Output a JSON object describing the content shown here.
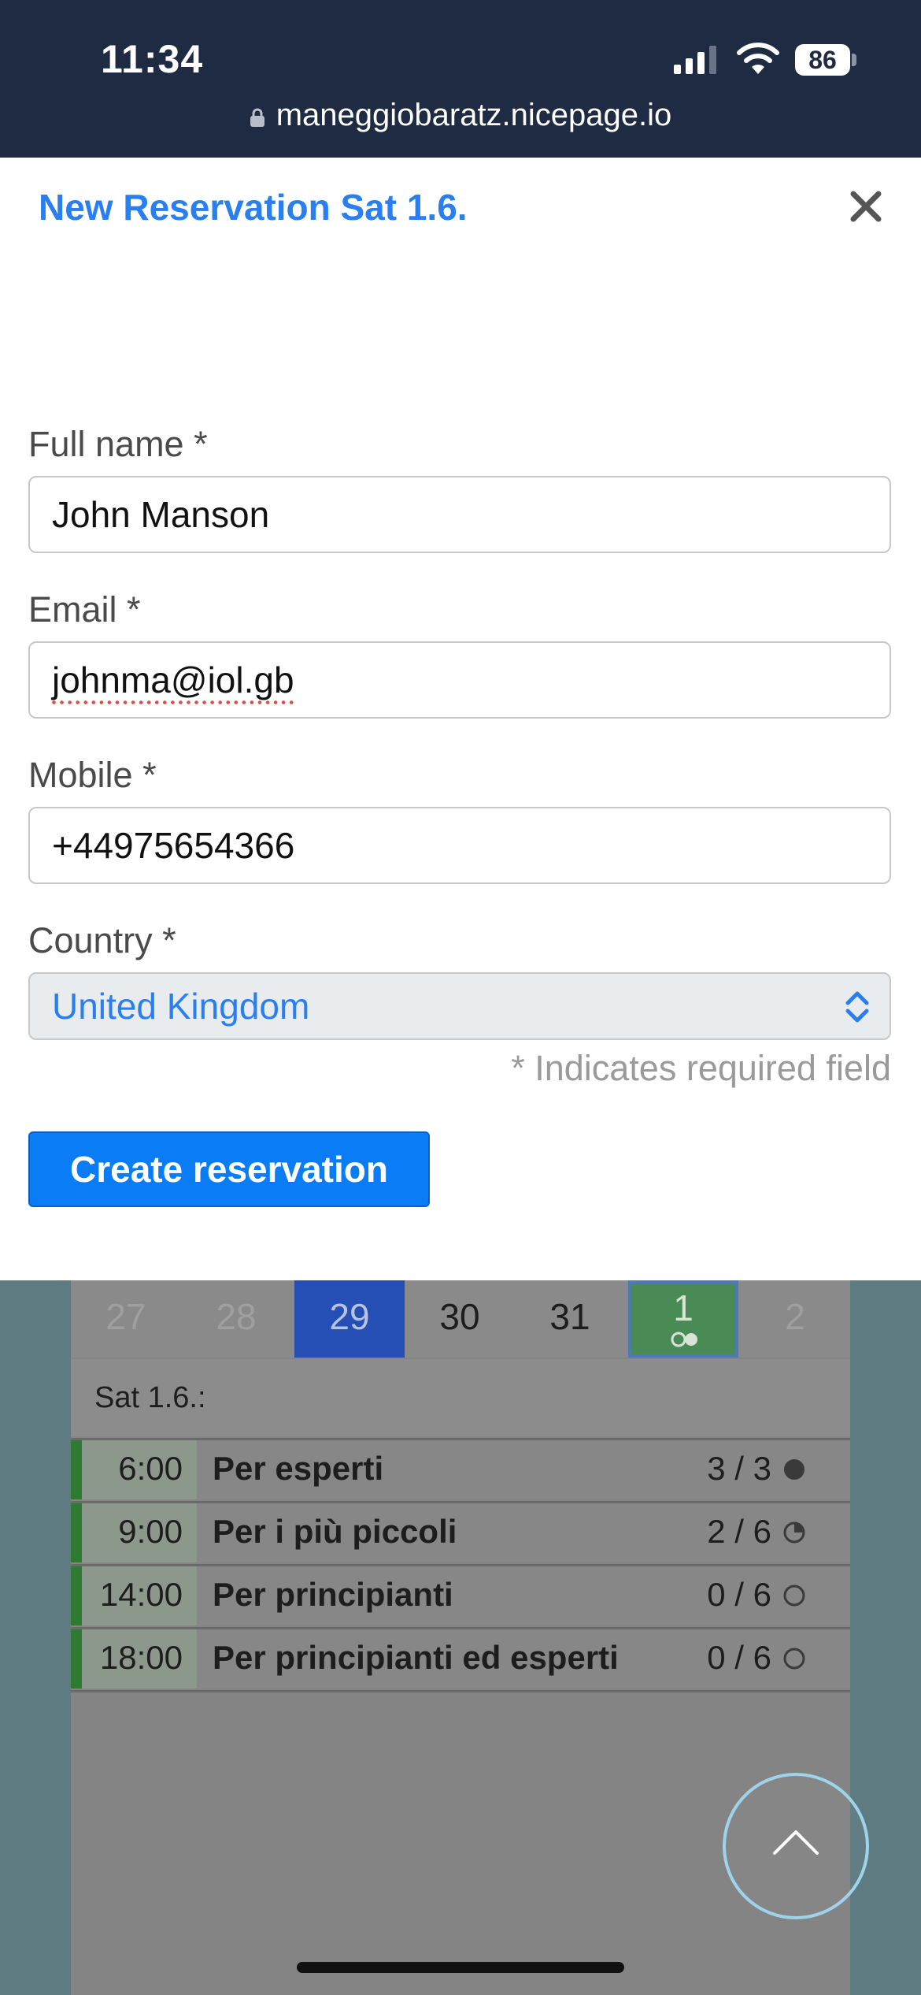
{
  "status_bar": {
    "time": "11:34",
    "battery": "86"
  },
  "browser": {
    "url": "maneggiobaratz.nicepage.io"
  },
  "modal": {
    "title": "New Reservation Sat 1.6.",
    "fields": {
      "full_name": {
        "label": "Full name *",
        "value": "John Manson"
      },
      "email": {
        "label": "Email *",
        "value": "johnma@iol.gb"
      },
      "mobile": {
        "label": "Mobile *",
        "value": "+44975654366"
      },
      "country": {
        "label": "Country *",
        "value": "United Kingdom"
      }
    },
    "required_note": "* Indicates required field",
    "submit_label": "Create reservation"
  },
  "calendar": {
    "days": [
      "27",
      "28",
      "29",
      "30",
      "31",
      "1",
      "2"
    ],
    "selected_day": "1",
    "date_header": "Sat 1.6.:",
    "slots": [
      {
        "time": "6:00",
        "name": "Per esperti",
        "count": "3 / 3",
        "occupancy": "full"
      },
      {
        "time": "9:00",
        "name": "Per i più piccoli",
        "count": "2 / 6",
        "occupancy": "partial"
      },
      {
        "time": "14:00",
        "name": "Per principianti",
        "count": "0 / 6",
        "occupancy": "empty"
      },
      {
        "time": "18:00",
        "name": "Per principianti ed esperti",
        "count": "0 / 6",
        "occupancy": "empty"
      }
    ]
  },
  "colors": {
    "accent": "#2a7ff0",
    "button": "#0a7cf5",
    "header": "#1f2b42",
    "slot_bar": "#2e7a33"
  }
}
